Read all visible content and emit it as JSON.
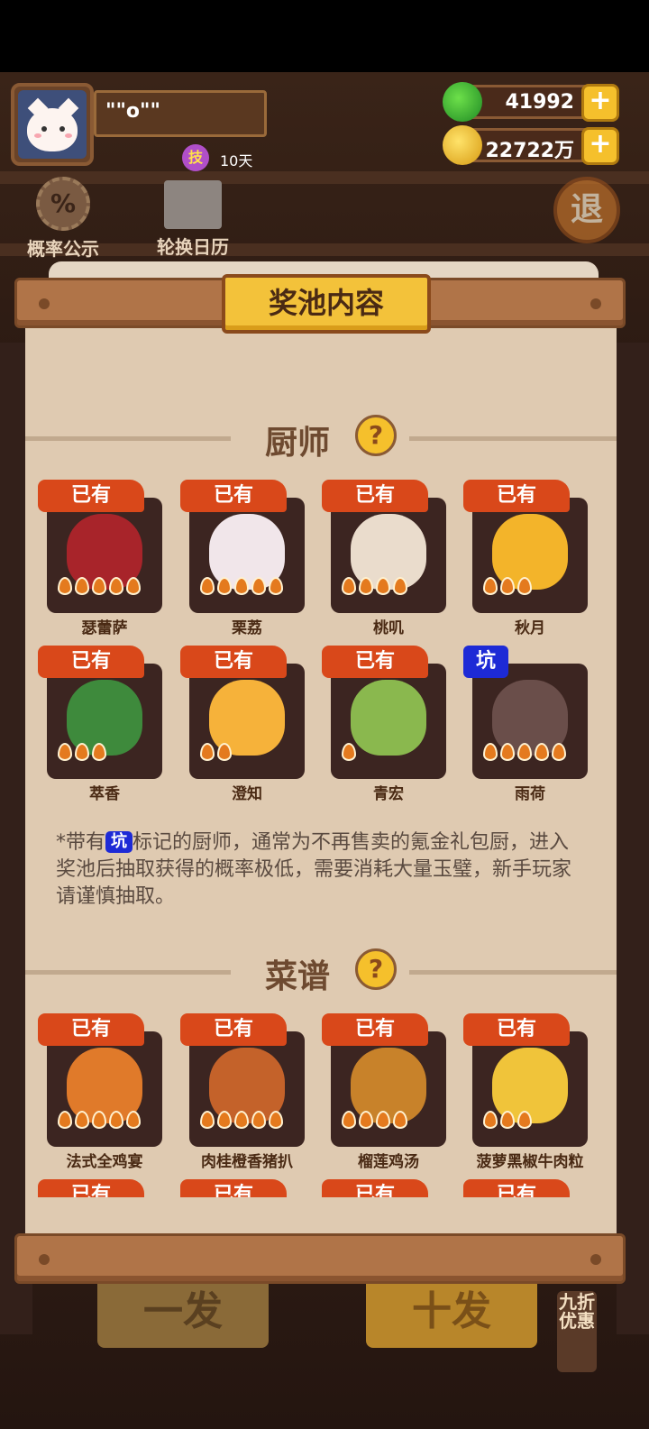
{
  "player": {
    "name": "\"\"o\"\"",
    "skill_badge": "技",
    "skill_days": "10天"
  },
  "currency": {
    "jade": "41992",
    "gold": "22722万",
    "add_symbol": "+"
  },
  "side_menu": {
    "probability": "概率公示",
    "probability_symbol": "%",
    "rotation_calendar": "轮换日历",
    "exit": "退"
  },
  "bottom": {
    "single_draw": "一发",
    "ten_draw": "十发",
    "discount": "九折优惠"
  },
  "modal": {
    "title": "奖池内容",
    "chef_section": "厨师",
    "recipe_section": "菜谱",
    "help_symbol": "?",
    "owned_tag": "已有",
    "pit_tag": "坑",
    "note_prefix": "*带有",
    "note_pit": "坑",
    "note_text": "标记的厨师，通常为不再售卖的氪金礼包厨，进入奖池后抽取获得的概率极低，需要消耗大量玉璧，新手玩家请谨慎抽取。",
    "chefs": [
      {
        "name": "瑟蕾萨",
        "tag": "已有",
        "stars": 5,
        "color": "#a8242a"
      },
      {
        "name": "栗荔",
        "tag": "已有",
        "stars": 5,
        "color": "#f1e6ea"
      },
      {
        "name": "桃叽",
        "tag": "已有",
        "stars": 4,
        "color": "#eadccc"
      },
      {
        "name": "秋月",
        "tag": "已有",
        "stars": 3,
        "color": "#f3b42a"
      },
      {
        "name": "萃香",
        "tag": "已有",
        "stars": 3,
        "color": "#3e8a3c"
      },
      {
        "name": "澄知",
        "tag": "已有",
        "stars": 2,
        "color": "#f6b23a"
      },
      {
        "name": "青宏",
        "tag": "已有",
        "stars": 1,
        "color": "#8ab84e"
      },
      {
        "name": "雨荷",
        "tag": "坑",
        "stars": 5,
        "color": "#6a4e4a"
      }
    ],
    "recipes": [
      {
        "name": "法式全鸡宴",
        "tag": "已有",
        "stars": 5,
        "color": "#e07a2a"
      },
      {
        "name": "肉桂橙香猪扒",
        "tag": "已有",
        "stars": 5,
        "color": "#c4622a"
      },
      {
        "name": "榴莲鸡汤",
        "tag": "已有",
        "stars": 4,
        "color": "#c8822a"
      },
      {
        "name": "菠萝黑椒牛肉粒",
        "tag": "已有",
        "stars": 3,
        "color": "#f0c43a"
      }
    ],
    "peek_tags": [
      "已有",
      "已有",
      "已有",
      "已有"
    ]
  },
  "colors": {
    "owned_tag": "#d9481a",
    "pit_tag": "#1d2ad6",
    "panel": "#dfcab1",
    "title_plate": "#f3c23a"
  },
  "icons": {
    "jade": "jade-coin-icon",
    "gold": "gold-coin-icon",
    "help": "question-icon",
    "star": "flame-star-icon"
  }
}
